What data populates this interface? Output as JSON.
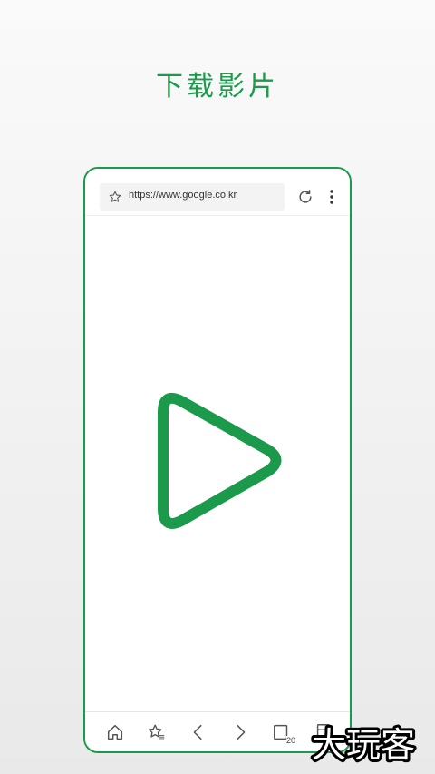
{
  "headline": "下载影片",
  "browser": {
    "url": "https://www.google.co.kr"
  },
  "toolbar": {
    "buttons": [
      {
        "name": "home",
        "icon": "home-icon"
      },
      {
        "name": "bookmarks",
        "icon": "bookmark-star-icon"
      },
      {
        "name": "back",
        "icon": "chevron-left-icon"
      },
      {
        "name": "forward",
        "icon": "chevron-right-icon"
      },
      {
        "name": "tabs",
        "icon": "tabs-icon"
      },
      {
        "name": "downloads",
        "icon": "page-icon"
      }
    ],
    "tab_count": "20"
  },
  "content": {
    "logo_icon": "play-triangle-icon"
  },
  "watermark": {
    "text": "大玩客"
  },
  "colors": {
    "accent": "#1a9a4a",
    "icon": "#555555"
  }
}
